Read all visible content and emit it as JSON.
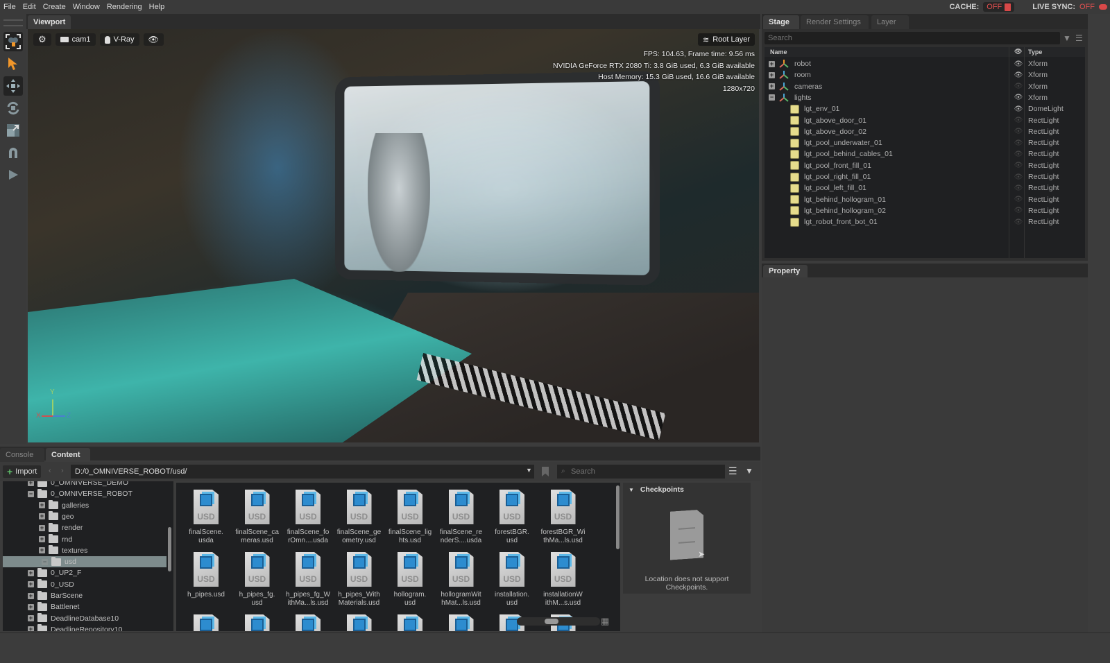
{
  "menubar": {
    "items": [
      "File",
      "Edit",
      "Create",
      "Window",
      "Rendering",
      "Help"
    ],
    "cache_label": "CACHE:",
    "cache_value": "OFF",
    "live_sync_label": "LIVE SYNC:",
    "live_sync_value": "OFF"
  },
  "colors": {
    "accent_orange": "#f0962a",
    "status_off": "#e05050",
    "selection": "#7d8b8c"
  },
  "toolrail": {
    "tools": [
      "select-mode-icon",
      "pointer-icon",
      "move-icon",
      "rotate-icon",
      "scale-icon",
      "snap-magnet-icon",
      "play-icon"
    ]
  },
  "viewport": {
    "tab": "Viewport",
    "camera": "cam1",
    "renderer": "V-Ray",
    "root_layer": "Root Layer",
    "stats": [
      "FPS: 104.63, Frame time: 9.56 ms",
      "NVIDIA GeForce RTX 2080 Ti: 3.8 GiB used,  6.3 GiB available",
      "Host Memory: 15.3 GiB used, 16.6 GiB available",
      "1280x720"
    ],
    "axis": {
      "x": "X",
      "y": "Y",
      "z": "Z"
    }
  },
  "stage": {
    "tabs": [
      "Stage",
      "Render Settings",
      "Layer"
    ],
    "search_placeholder": "Search",
    "columns": {
      "name": "Name",
      "type": "Type"
    },
    "rows": [
      {
        "name": "robot",
        "type": "Xform",
        "expander": "+",
        "visible": true,
        "icon": "xform-robot-icon",
        "level": 0
      },
      {
        "name": "room",
        "type": "Xform",
        "expander": "+",
        "visible": true,
        "icon": "xform-icon",
        "level": 0
      },
      {
        "name": "cameras",
        "type": "Xform",
        "expander": "+",
        "visible": false,
        "icon": "xform-icon",
        "level": 0
      },
      {
        "name": "lights",
        "type": "Xform",
        "expander": "−",
        "visible": true,
        "icon": "xform-icon",
        "level": 0
      },
      {
        "name": "lgt_env_01",
        "type": "DomeLight",
        "visible": true,
        "icon": "light-icon",
        "level": 1
      },
      {
        "name": "lgt_above_door_01",
        "type": "RectLight",
        "visible": false,
        "icon": "light-icon",
        "level": 1
      },
      {
        "name": "lgt_above_door_02",
        "type": "RectLight",
        "visible": false,
        "icon": "light-icon",
        "level": 1
      },
      {
        "name": "lgt_pool_underwater_01",
        "type": "RectLight",
        "visible": false,
        "icon": "light-icon",
        "level": 1
      },
      {
        "name": "lgt_pool_behind_cables_01",
        "type": "RectLight",
        "visible": false,
        "icon": "light-icon",
        "level": 1
      },
      {
        "name": "lgt_pool_front_fill_01",
        "type": "RectLight",
        "visible": false,
        "icon": "light-icon",
        "level": 1
      },
      {
        "name": "lgt_pool_right_fill_01",
        "type": "RectLight",
        "visible": false,
        "icon": "light-icon",
        "level": 1
      },
      {
        "name": "lgt_pool_left_fill_01",
        "type": "RectLight",
        "visible": false,
        "icon": "light-icon",
        "level": 1
      },
      {
        "name": "lgt_behind_hollogram_01",
        "type": "RectLight",
        "visible": false,
        "icon": "light-icon",
        "level": 1
      },
      {
        "name": "lgt_behind_hollogram_02",
        "type": "RectLight",
        "visible": false,
        "icon": "light-icon",
        "level": 1
      },
      {
        "name": "lgt_robot_front_bot_01",
        "type": "RectLight",
        "visible": false,
        "icon": "light-icon",
        "level": 1
      }
    ]
  },
  "property": {
    "tab": "Property"
  },
  "bottom": {
    "tabs": [
      "Console",
      "Content"
    ],
    "import_label": "Import",
    "path": "D:/0_OMNIVERSE_ROBOT/usd/",
    "search_placeholder": "Search",
    "folders": [
      {
        "name": "0_OMNIVERSE_DEMO",
        "level": 0,
        "expander": "+"
      },
      {
        "name": "0_OMNIVERSE_ROBOT",
        "level": 0,
        "expander": "−",
        "open": true
      },
      {
        "name": "galleries",
        "level": 1,
        "expander": "+"
      },
      {
        "name": "geo",
        "level": 1,
        "expander": "+"
      },
      {
        "name": "render",
        "level": 1,
        "expander": "+"
      },
      {
        "name": "rnd",
        "level": 1,
        "expander": "+"
      },
      {
        "name": "textures",
        "level": 1,
        "expander": "+"
      },
      {
        "name": "usd",
        "level": 1,
        "expander": "−",
        "selected": true
      },
      {
        "name": "0_UP2_F",
        "level": 0,
        "expander": "+"
      },
      {
        "name": "0_USD",
        "level": 0,
        "expander": "+"
      },
      {
        "name": "BarScene",
        "level": 0,
        "expander": "+"
      },
      {
        "name": "Battlenet",
        "level": 0,
        "expander": "+"
      },
      {
        "name": "DeadlineDatabase10",
        "level": 0,
        "expander": "+"
      },
      {
        "name": "DeadlineRepository10",
        "level": 0,
        "expander": "+"
      }
    ],
    "files": [
      [
        "finalScene.",
        "usda"
      ],
      [
        "finalScene_ca",
        "meras.usd"
      ],
      [
        "finalScene_fo",
        "rOmn....usda"
      ],
      [
        "finalScene_ge",
        "ometry.usd"
      ],
      [
        "finalScene_lig",
        "hts.usd"
      ],
      [
        "finalScene_re",
        "nderS....usda"
      ],
      [
        "forestBGR.",
        "usd"
      ],
      [
        "forestBGR_Wi",
        "thMa...ls.usd"
      ],
      [
        "h_pipes.usd",
        ""
      ],
      [
        "h_pipes_fg.",
        "usd"
      ],
      [
        "h_pipes_fg_W",
        "ithMa...ls.usd"
      ],
      [
        "h_pipes_With",
        "Materials.usd"
      ],
      [
        "hollogram.",
        "usd"
      ],
      [
        "hollogramWit",
        "hMat...ls.usd"
      ],
      [
        "installation.",
        "usd"
      ],
      [
        "installationW",
        "ithM...s.usd"
      ],
      [
        "",
        ""
      ],
      [
        "",
        ""
      ],
      [
        "",
        ""
      ],
      [
        "",
        ""
      ],
      [
        "",
        ""
      ],
      [
        "",
        ""
      ],
      [
        "",
        ""
      ],
      [
        "",
        ""
      ]
    ],
    "file_icon_label": "USD",
    "checkpoints": {
      "title": "Checkpoints",
      "message_line1": "Location does not support",
      "message_line2": "Checkpoints."
    }
  }
}
